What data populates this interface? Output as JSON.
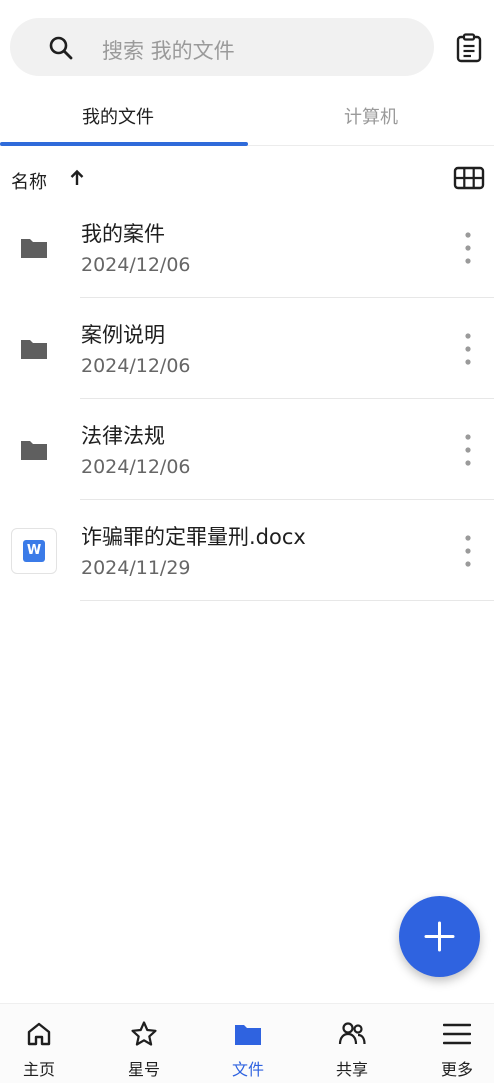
{
  "search": {
    "placeholder": "搜索 我的文件"
  },
  "tabs": [
    {
      "label": "我的文件",
      "active": true
    },
    {
      "label": "计算机",
      "active": false
    }
  ],
  "sort": {
    "label": "名称"
  },
  "files": [
    {
      "name": "我的案件",
      "date": "2024/12/06",
      "icon": "folder-icon"
    },
    {
      "name": "案例说明",
      "date": "2024/12/06",
      "icon": "folder-icon"
    },
    {
      "name": "法律法规",
      "date": "2024/12/06",
      "icon": "folder-icon"
    },
    {
      "name": "诈骗罪的定罪量刑.docx",
      "date": "2024/11/29",
      "icon": "word-document-icon",
      "badge": "W"
    }
  ],
  "bottom_nav": [
    {
      "label": "主页",
      "icon": "home-icon"
    },
    {
      "label": "星号",
      "icon": "star-icon"
    },
    {
      "label": "文件",
      "icon": "folder-icon",
      "active": true
    },
    {
      "label": "共享",
      "icon": "people-icon"
    },
    {
      "label": "更多",
      "icon": "menu-icon"
    }
  ],
  "colors": {
    "accent": "#2f63e0",
    "folder": "#5f5f5f",
    "word": "#3b7be8"
  }
}
